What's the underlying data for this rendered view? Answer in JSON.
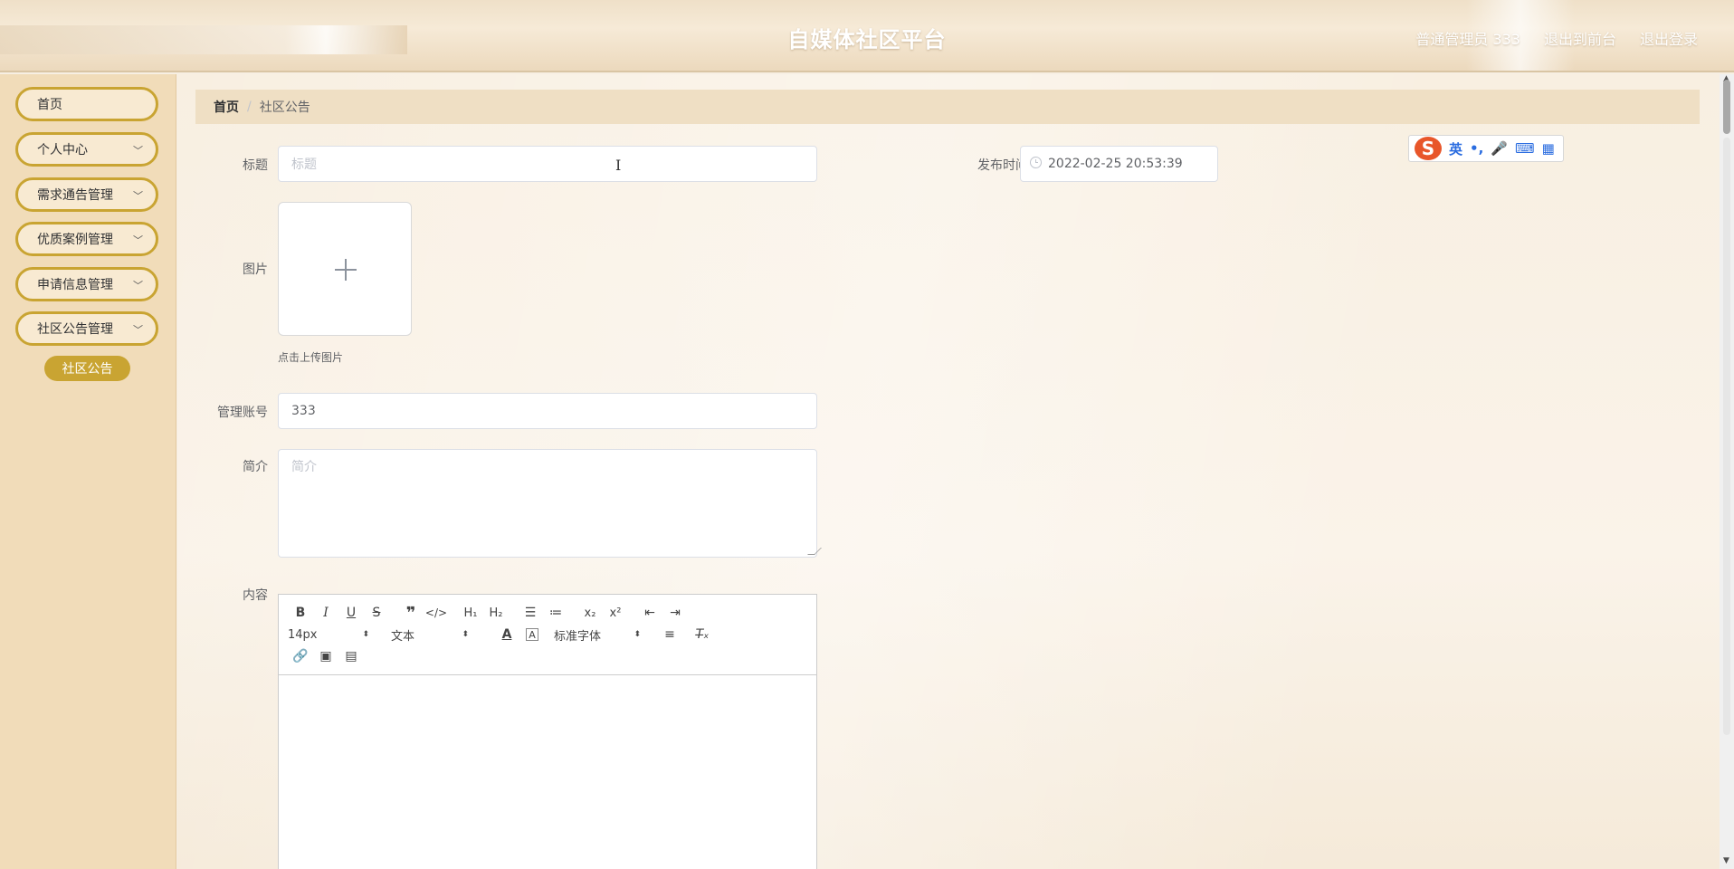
{
  "header": {
    "title": "自媒体社区平台",
    "user_label": "普通管理员 333",
    "front_label": "退出到前台",
    "logout_label": "退出登录"
  },
  "sidebar": {
    "items": [
      {
        "label": "首页"
      },
      {
        "label": "个人中心"
      },
      {
        "label": "需求通告管理"
      },
      {
        "label": "优质案例管理"
      },
      {
        "label": "申请信息管理"
      },
      {
        "label": "社区公告管理"
      }
    ],
    "active_sub": "社区公告"
  },
  "breadcrumb": {
    "home": "首页",
    "separator": "/",
    "current": "社区公告"
  },
  "form": {
    "title_label": "标题",
    "title_placeholder": "标题",
    "publish_time_label": "发布时间",
    "publish_time_value": "2022-02-25 20:53:39",
    "image_label": "图片",
    "upload_tip": "点击上传图片",
    "account_label": "管理账号",
    "account_value": "333",
    "intro_label": "简介",
    "intro_placeholder": "简介",
    "content_label": "内容"
  },
  "editor": {
    "font_size": "14px",
    "header_select": "文本",
    "font_family": "标准字体"
  },
  "ime": {
    "logo": "S",
    "mode": "英"
  },
  "colors": {
    "accent": "#c9a432",
    "sidebar_bg": "#f1dcb9",
    "breadcrumb_bg": "#efdfc4"
  }
}
